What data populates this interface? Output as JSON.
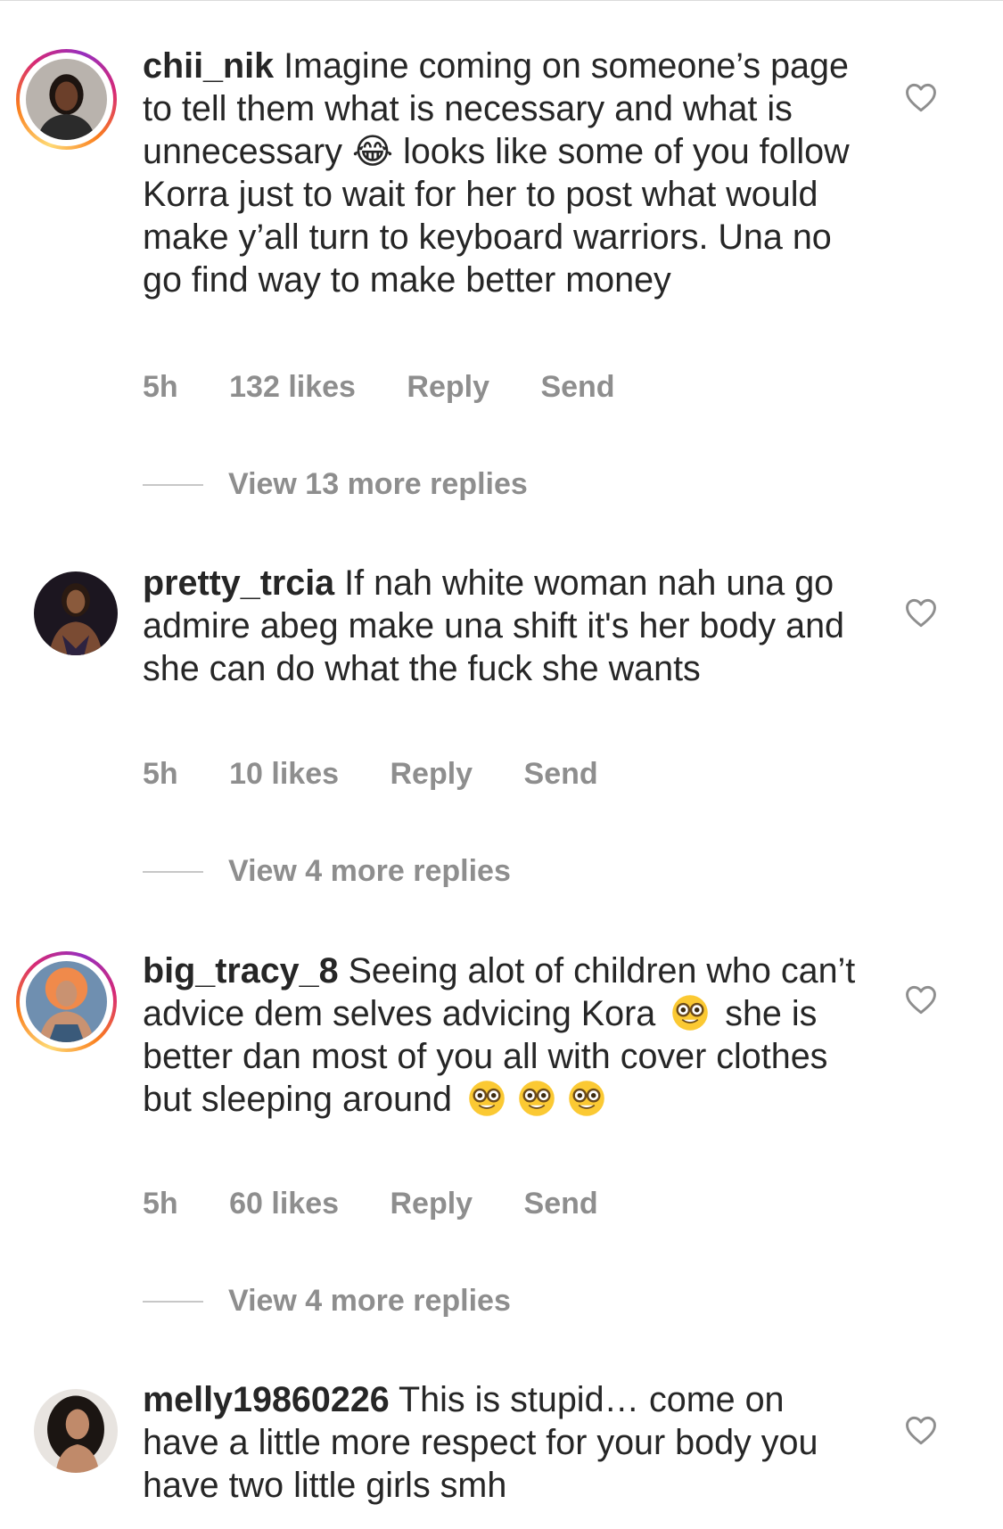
{
  "comments": [
    {
      "username": "chii_nik",
      "text": "Imagine coming on someone’s page to tell them what is necessary and what is unnecessary 😂 looks like some of you follow Korra just to wait for her to post what would make y’all turn to keyboard warriors. Una no go find way to make better money",
      "time": "5h",
      "likes": "132 likes",
      "reply": "Reply",
      "send": "Send",
      "view_replies": "View 13 more replies",
      "has_story_ring": true
    },
    {
      "username": "pretty_trcia",
      "text": "If nah white woman nah una go admire abeg make una shift it's her body and she can do what the fuck she wants",
      "time": "5h",
      "likes": "10 likes",
      "reply": "Reply",
      "send": "Send",
      "view_replies": "View 4 more replies",
      "has_story_ring": false
    },
    {
      "username": "big_tracy_8",
      "text_parts": [
        "Seeing alot of children who can’t advice dem selves advicing Kora",
        "she is better dan most of  you all with cover clothes but sleeping around"
      ],
      "emoji": "🤓",
      "time": "5h",
      "likes": "60 likes",
      "reply": "Reply",
      "send": "Send",
      "view_replies": "View 4 more replies",
      "has_story_ring": true
    },
    {
      "username": "melly19860226",
      "text": "This is stupid… come on have a little more respect for your body you have two little girls smh",
      "has_story_ring": false
    }
  ],
  "icons": {
    "like": "heart-outline-icon",
    "thread": "reply-thread-line"
  },
  "colors": {
    "text": "#262626",
    "muted": "#8e8e8e",
    "story_ring": [
      "#feda75",
      "#fa7e1e",
      "#d62976",
      "#962fbf"
    ]
  }
}
